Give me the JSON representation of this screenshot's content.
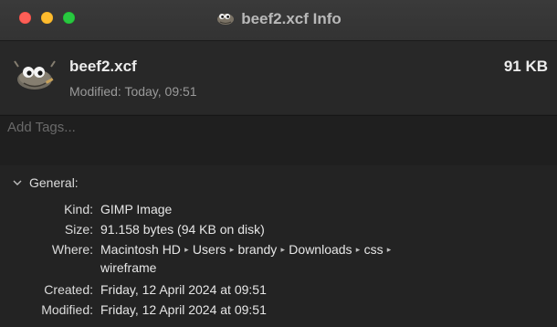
{
  "window": {
    "title": "beef2.xcf Info",
    "title_icon": "gimp-wilber-icon",
    "controls": [
      "close",
      "minimize",
      "zoom"
    ]
  },
  "file": {
    "icon": "gimp-wilber-icon",
    "name": "beef2.xcf",
    "size": "91 KB",
    "modified_summary": "Modified: Today, 09:51"
  },
  "tags": {
    "placeholder": "Add Tags...",
    "value": ""
  },
  "general": {
    "heading": "General:",
    "expanded": true,
    "kind_label": "Kind:",
    "kind_value": "GIMP Image",
    "size_label": "Size:",
    "size_value": "91.158 bytes (94 KB on disk)",
    "where_label": "Where:",
    "where_path": [
      "Macintosh HD",
      "Users",
      "brandy",
      "Downloads",
      "css",
      "wireframe"
    ],
    "created_label": "Created:",
    "created_value": "Friday, 12 April 2024 at 09:51",
    "modified_label": "Modified:",
    "modified_value": "Friday, 12 April 2024 at 09:51"
  },
  "colors": {
    "close": "#fe5f57",
    "minimize": "#febc2e",
    "zoom": "#28c840",
    "background": "#232323"
  }
}
